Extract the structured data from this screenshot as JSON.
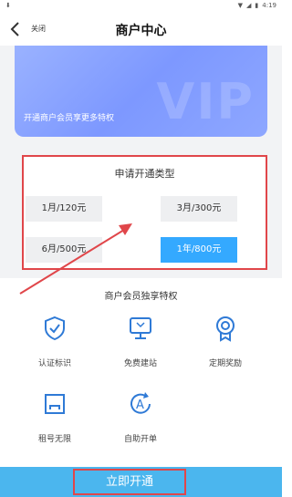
{
  "status_bar": {
    "left": "⬇",
    "time": "4:19"
  },
  "nav": {
    "close_label": "关闭",
    "title": "商户中心"
  },
  "banner": {
    "watermark": "VIP",
    "tagline": "开通商户会员享更多特权"
  },
  "plan_section": {
    "title": "申请开通类型",
    "options": [
      {
        "label": "1月/120元",
        "selected": false
      },
      {
        "label": "3月/300元",
        "selected": false
      },
      {
        "label": "6月/500元",
        "selected": false
      },
      {
        "label": "1年/800元",
        "selected": true
      }
    ]
  },
  "perks": {
    "title": "商户会员独享特权",
    "items": [
      {
        "label": "认证标识",
        "icon": "shield-check-icon"
      },
      {
        "label": "免费建站",
        "icon": "monitor-icon"
      },
      {
        "label": "定期奖励",
        "icon": "award-icon"
      },
      {
        "label": "租号无限",
        "icon": "frame-icon"
      },
      {
        "label": "自助开单",
        "icon": "refresh-a-icon"
      }
    ]
  },
  "cta": {
    "label": "立即开通"
  },
  "colors": {
    "accent": "#34a9ff",
    "cta_bg": "#4bb6ee",
    "highlight_border": "#e0464a",
    "annotation_arrow": "#e0464a"
  }
}
